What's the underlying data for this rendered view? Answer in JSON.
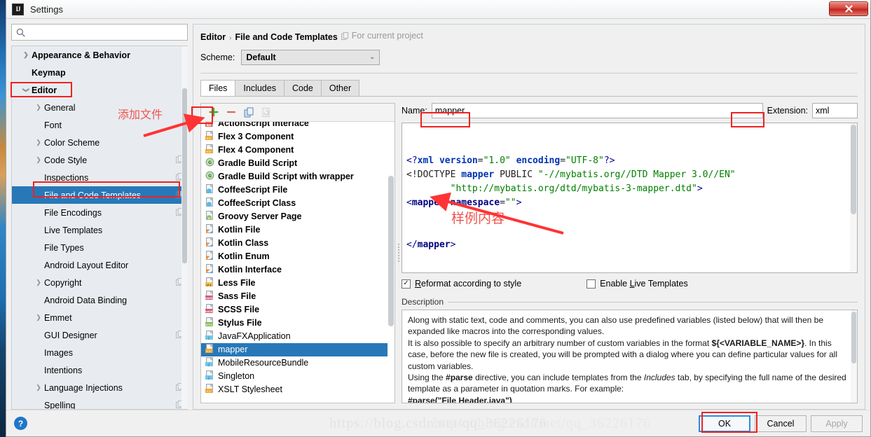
{
  "window": {
    "title": "Settings",
    "logo_text": "IJ",
    "close_label": "✕"
  },
  "search": {
    "placeholder": "",
    "value": "",
    "icon": "search-icon"
  },
  "sidebar": {
    "items": [
      {
        "label": "Appearance & Behavior",
        "depth": 0,
        "arrow": "right",
        "bold": true,
        "copy": false,
        "selected": false
      },
      {
        "label": "Keymap",
        "depth": 0,
        "arrow": "none",
        "bold": true,
        "copy": false,
        "selected": false
      },
      {
        "label": "Editor",
        "depth": 0,
        "arrow": "down",
        "bold": true,
        "copy": false,
        "selected": false
      },
      {
        "label": "General",
        "depth": 1,
        "arrow": "right",
        "bold": false,
        "copy": false,
        "selected": false
      },
      {
        "label": "Font",
        "depth": 1,
        "arrow": "none",
        "bold": false,
        "copy": false,
        "selected": false
      },
      {
        "label": "Color Scheme",
        "depth": 1,
        "arrow": "right",
        "bold": false,
        "copy": false,
        "selected": false
      },
      {
        "label": "Code Style",
        "depth": 1,
        "arrow": "right",
        "bold": false,
        "copy": true,
        "selected": false
      },
      {
        "label": "Inspections",
        "depth": 1,
        "arrow": "none",
        "bold": false,
        "copy": true,
        "selected": false
      },
      {
        "label": "File and Code Templates",
        "depth": 1,
        "arrow": "none",
        "bold": false,
        "copy": true,
        "selected": true
      },
      {
        "label": "File Encodings",
        "depth": 1,
        "arrow": "none",
        "bold": false,
        "copy": true,
        "selected": false
      },
      {
        "label": "Live Templates",
        "depth": 1,
        "arrow": "none",
        "bold": false,
        "copy": false,
        "selected": false
      },
      {
        "label": "File Types",
        "depth": 1,
        "arrow": "none",
        "bold": false,
        "copy": false,
        "selected": false
      },
      {
        "label": "Android Layout Editor",
        "depth": 1,
        "arrow": "none",
        "bold": false,
        "copy": false,
        "selected": false
      },
      {
        "label": "Copyright",
        "depth": 1,
        "arrow": "right",
        "bold": false,
        "copy": true,
        "selected": false
      },
      {
        "label": "Android Data Binding",
        "depth": 1,
        "arrow": "none",
        "bold": false,
        "copy": false,
        "selected": false
      },
      {
        "label": "Emmet",
        "depth": 1,
        "arrow": "right",
        "bold": false,
        "copy": false,
        "selected": false
      },
      {
        "label": "GUI Designer",
        "depth": 1,
        "arrow": "none",
        "bold": false,
        "copy": true,
        "selected": false
      },
      {
        "label": "Images",
        "depth": 1,
        "arrow": "none",
        "bold": false,
        "copy": false,
        "selected": false
      },
      {
        "label": "Intentions",
        "depth": 1,
        "arrow": "none",
        "bold": false,
        "copy": false,
        "selected": false
      },
      {
        "label": "Language Injections",
        "depth": 1,
        "arrow": "right",
        "bold": false,
        "copy": true,
        "selected": false
      },
      {
        "label": "Spelling",
        "depth": 1,
        "arrow": "none",
        "bold": false,
        "copy": true,
        "selected": false
      }
    ]
  },
  "breadcrumb": {
    "parent": "Editor",
    "separator": "›",
    "current": "File and Code Templates",
    "scope": "For current project"
  },
  "scheme": {
    "label": "Scheme:",
    "value": "Default",
    "chevron": "⌄"
  },
  "tabs": [
    {
      "label": "Files",
      "active": true
    },
    {
      "label": "Includes",
      "active": false
    },
    {
      "label": "Code",
      "active": false
    },
    {
      "label": "Other",
      "active": false
    }
  ],
  "templates_toolbar": {
    "add": "add-icon",
    "remove": "remove-icon",
    "copy": "copy-icon",
    "reset": "reset-icon"
  },
  "templates": [
    {
      "label": "ActionScript Interface",
      "icon": "as-file-icon",
      "bold": true,
      "selected": false
    },
    {
      "label": "Flex 3 Component",
      "icon": "flex-file-icon",
      "bold": true,
      "selected": false
    },
    {
      "label": "Flex 4 Component",
      "icon": "flex-file-icon",
      "bold": true,
      "selected": false
    },
    {
      "label": "Gradle Build Script",
      "icon": "gradle-icon",
      "bold": true,
      "selected": false
    },
    {
      "label": "Gradle Build Script with wrapper",
      "icon": "gradle-icon",
      "bold": true,
      "selected": false
    },
    {
      "label": "CoffeeScript File",
      "icon": "coffee-file-icon",
      "bold": true,
      "selected": false
    },
    {
      "label": "CoffeeScript Class",
      "icon": "coffee-file-icon",
      "bold": true,
      "selected": false
    },
    {
      "label": "Groovy Server Page",
      "icon": "groovy-file-icon",
      "bold": true,
      "selected": false
    },
    {
      "label": "Kotlin File",
      "icon": "kotlin-file-icon",
      "bold": true,
      "selected": false
    },
    {
      "label": "Kotlin Class",
      "icon": "kotlin-file-icon",
      "bold": true,
      "selected": false
    },
    {
      "label": "Kotlin Enum",
      "icon": "kotlin-file-icon",
      "bold": true,
      "selected": false
    },
    {
      "label": "Kotlin Interface",
      "icon": "kotlin-file-icon",
      "bold": true,
      "selected": false
    },
    {
      "label": "Less File",
      "icon": "less-file-icon",
      "bold": true,
      "selected": false
    },
    {
      "label": "Sass File",
      "icon": "sass-file-icon",
      "bold": true,
      "selected": false
    },
    {
      "label": "SCSS File",
      "icon": "sass-file-icon",
      "bold": true,
      "selected": false
    },
    {
      "label": "Stylus File",
      "icon": "stylus-file-icon",
      "bold": true,
      "selected": false
    },
    {
      "label": "JavaFXApplication",
      "icon": "java-file-icon",
      "bold": false,
      "selected": false
    },
    {
      "label": "mapper",
      "icon": "xml-file-icon",
      "bold": false,
      "selected": true
    },
    {
      "label": "MobileResourceBundle",
      "icon": "java-file-icon",
      "bold": false,
      "selected": false
    },
    {
      "label": "Singleton",
      "icon": "java-file-icon",
      "bold": false,
      "selected": false
    },
    {
      "label": "XSLT Stylesheet",
      "icon": "xml-file-icon",
      "bold": false,
      "selected": false
    }
  ],
  "editor": {
    "name_label": "Name:",
    "name_value": "mapper",
    "extension_label": "Extension:",
    "extension_value": "xml",
    "code_lines": [
      "<?xml version=\"1.0\" encoding=\"UTF-8\"?>",
      "<!DOCTYPE mapper PUBLIC \"-//mybatis.org//DTD Mapper 3.0//EN\"",
      "        \"http://mybatis.org/dtd/mybatis-3-mapper.dtd\">",
      "<mapper namespace=\"\">",
      "",
      "",
      "</mapper>"
    ]
  },
  "options": {
    "reformat": {
      "label": "Reformat according to style",
      "checked": true,
      "mark": "✓"
    },
    "live_templates": {
      "label": "Enable Live Templates",
      "checked": false,
      "mark": ""
    }
  },
  "description": {
    "title": "Description",
    "paragraphs": [
      "Along with static text, code and comments, you can also use predefined variables (listed below) that will then be expanded like macros into the corresponding values.",
      "It is also possible to specify an arbitrary number of custom variables in the format ${<VARIABLE_NAME>}. In this case, before the new file is created, you will be prompted with a dialog where you can define particular values for all custom variables.",
      "Using the #parse directive, you can include templates from the Includes tab, by specifying the full name of the desired template as a parameter in quotation marks. For example:",
      "#parse(\"File Header.java\")"
    ]
  },
  "footer": {
    "help": "?",
    "ok": "OK",
    "cancel": "Cancel",
    "apply": "Apply",
    "watermark": "https://blog.csdn.net/qq_36226176"
  },
  "annotations": [
    {
      "name": "add-file-note",
      "text": "添加文件"
    },
    {
      "name": "sample-content-note",
      "text": "样例内容"
    }
  ],
  "colors": {
    "accent": "#2878b8",
    "annotation": "#f0534f",
    "highlight_box": "#ee2222"
  }
}
